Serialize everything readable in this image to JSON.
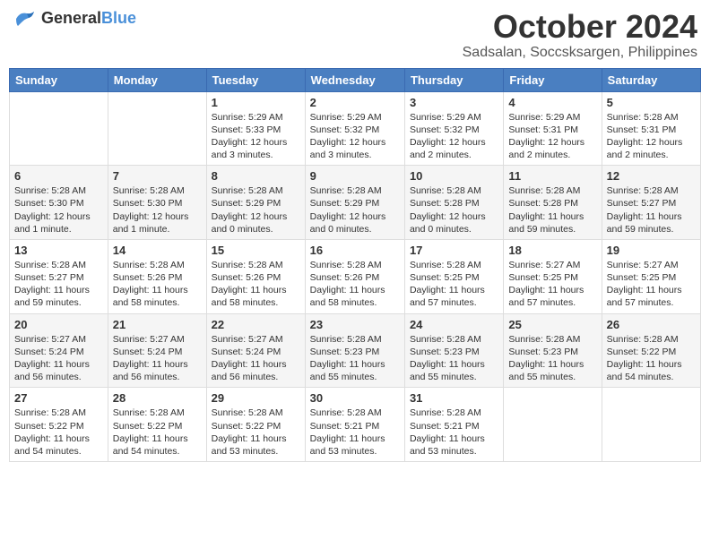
{
  "header": {
    "logo": {
      "text_general": "General",
      "text_blue": "Blue"
    },
    "month": "October 2024",
    "location": "Sadsalan, Soccsksargen, Philippines"
  },
  "weekdays": [
    "Sunday",
    "Monday",
    "Tuesday",
    "Wednesday",
    "Thursday",
    "Friday",
    "Saturday"
  ],
  "weeks": [
    [
      {
        "day": "",
        "info": ""
      },
      {
        "day": "",
        "info": ""
      },
      {
        "day": "1",
        "info": "Sunrise: 5:29 AM\nSunset: 5:33 PM\nDaylight: 12 hours\nand 3 minutes."
      },
      {
        "day": "2",
        "info": "Sunrise: 5:29 AM\nSunset: 5:32 PM\nDaylight: 12 hours\nand 3 minutes."
      },
      {
        "day": "3",
        "info": "Sunrise: 5:29 AM\nSunset: 5:32 PM\nDaylight: 12 hours\nand 2 minutes."
      },
      {
        "day": "4",
        "info": "Sunrise: 5:29 AM\nSunset: 5:31 PM\nDaylight: 12 hours\nand 2 minutes."
      },
      {
        "day": "5",
        "info": "Sunrise: 5:28 AM\nSunset: 5:31 PM\nDaylight: 12 hours\nand 2 minutes."
      }
    ],
    [
      {
        "day": "6",
        "info": "Sunrise: 5:28 AM\nSunset: 5:30 PM\nDaylight: 12 hours\nand 1 minute."
      },
      {
        "day": "7",
        "info": "Sunrise: 5:28 AM\nSunset: 5:30 PM\nDaylight: 12 hours\nand 1 minute."
      },
      {
        "day": "8",
        "info": "Sunrise: 5:28 AM\nSunset: 5:29 PM\nDaylight: 12 hours\nand 0 minutes."
      },
      {
        "day": "9",
        "info": "Sunrise: 5:28 AM\nSunset: 5:29 PM\nDaylight: 12 hours\nand 0 minutes."
      },
      {
        "day": "10",
        "info": "Sunrise: 5:28 AM\nSunset: 5:28 PM\nDaylight: 12 hours\nand 0 minutes."
      },
      {
        "day": "11",
        "info": "Sunrise: 5:28 AM\nSunset: 5:28 PM\nDaylight: 11 hours\nand 59 minutes."
      },
      {
        "day": "12",
        "info": "Sunrise: 5:28 AM\nSunset: 5:27 PM\nDaylight: 11 hours\nand 59 minutes."
      }
    ],
    [
      {
        "day": "13",
        "info": "Sunrise: 5:28 AM\nSunset: 5:27 PM\nDaylight: 11 hours\nand 59 minutes."
      },
      {
        "day": "14",
        "info": "Sunrise: 5:28 AM\nSunset: 5:26 PM\nDaylight: 11 hours\nand 58 minutes."
      },
      {
        "day": "15",
        "info": "Sunrise: 5:28 AM\nSunset: 5:26 PM\nDaylight: 11 hours\nand 58 minutes."
      },
      {
        "day": "16",
        "info": "Sunrise: 5:28 AM\nSunset: 5:26 PM\nDaylight: 11 hours\nand 58 minutes."
      },
      {
        "day": "17",
        "info": "Sunrise: 5:28 AM\nSunset: 5:25 PM\nDaylight: 11 hours\nand 57 minutes."
      },
      {
        "day": "18",
        "info": "Sunrise: 5:27 AM\nSunset: 5:25 PM\nDaylight: 11 hours\nand 57 minutes."
      },
      {
        "day": "19",
        "info": "Sunrise: 5:27 AM\nSunset: 5:25 PM\nDaylight: 11 hours\nand 57 minutes."
      }
    ],
    [
      {
        "day": "20",
        "info": "Sunrise: 5:27 AM\nSunset: 5:24 PM\nDaylight: 11 hours\nand 56 minutes."
      },
      {
        "day": "21",
        "info": "Sunrise: 5:27 AM\nSunset: 5:24 PM\nDaylight: 11 hours\nand 56 minutes."
      },
      {
        "day": "22",
        "info": "Sunrise: 5:27 AM\nSunset: 5:24 PM\nDaylight: 11 hours\nand 56 minutes."
      },
      {
        "day": "23",
        "info": "Sunrise: 5:28 AM\nSunset: 5:23 PM\nDaylight: 11 hours\nand 55 minutes."
      },
      {
        "day": "24",
        "info": "Sunrise: 5:28 AM\nSunset: 5:23 PM\nDaylight: 11 hours\nand 55 minutes."
      },
      {
        "day": "25",
        "info": "Sunrise: 5:28 AM\nSunset: 5:23 PM\nDaylight: 11 hours\nand 55 minutes."
      },
      {
        "day": "26",
        "info": "Sunrise: 5:28 AM\nSunset: 5:22 PM\nDaylight: 11 hours\nand 54 minutes."
      }
    ],
    [
      {
        "day": "27",
        "info": "Sunrise: 5:28 AM\nSunset: 5:22 PM\nDaylight: 11 hours\nand 54 minutes."
      },
      {
        "day": "28",
        "info": "Sunrise: 5:28 AM\nSunset: 5:22 PM\nDaylight: 11 hours\nand 54 minutes."
      },
      {
        "day": "29",
        "info": "Sunrise: 5:28 AM\nSunset: 5:22 PM\nDaylight: 11 hours\nand 53 minutes."
      },
      {
        "day": "30",
        "info": "Sunrise: 5:28 AM\nSunset: 5:21 PM\nDaylight: 11 hours\nand 53 minutes."
      },
      {
        "day": "31",
        "info": "Sunrise: 5:28 AM\nSunset: 5:21 PM\nDaylight: 11 hours\nand 53 minutes."
      },
      {
        "day": "",
        "info": ""
      },
      {
        "day": "",
        "info": ""
      }
    ]
  ]
}
